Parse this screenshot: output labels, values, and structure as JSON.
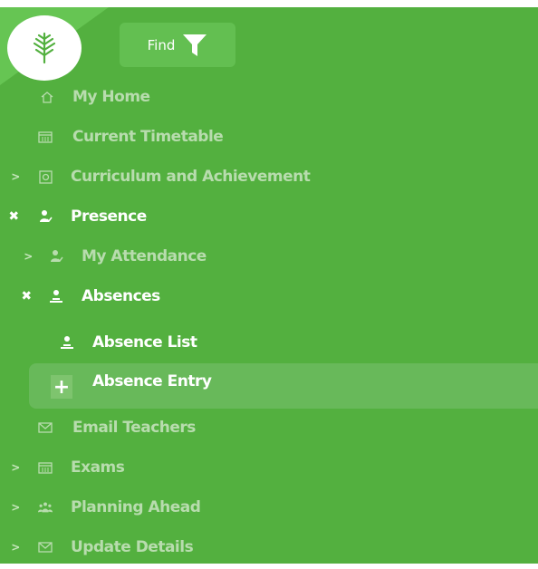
{
  "find": {
    "label": "Find"
  },
  "menu": {
    "my_home": "My Home",
    "current_timetable": "Current Timetable",
    "curriculum": "Curriculum and Achievement",
    "presence": "Presence",
    "my_attendance": "My Attendance",
    "absences": "Absences",
    "absence_list": "Absence List",
    "absence_entry": "Absence Entry",
    "email_teachers": "Email Teachers",
    "exams": "Exams",
    "planning_ahead": "Planning Ahead",
    "update_details": "Update Details"
  },
  "colors": {
    "sidebar": "#53b03f",
    "muted_text": "#b8dcae",
    "active_text": "#ffffff",
    "highlight": "#68b95a"
  }
}
